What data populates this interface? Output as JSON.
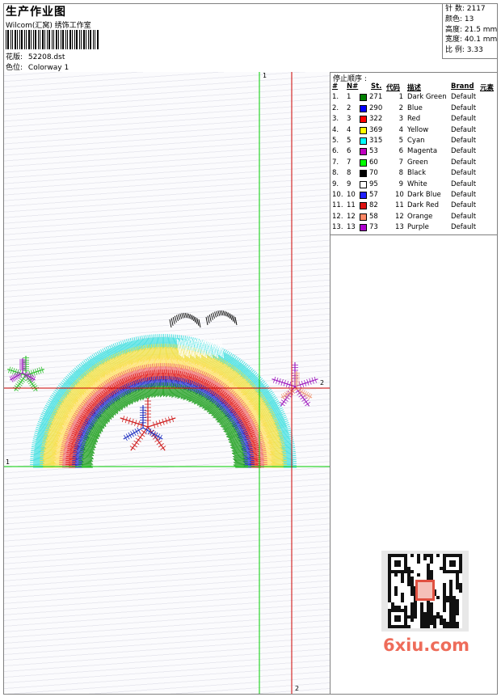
{
  "header": {
    "title": "生产作业图",
    "company": "Wilcom(汇窝) 绣饰工作室",
    "design_label": "花版:",
    "design_value": "52208.dst",
    "colorway_label": "色位:",
    "colorway_value": "Colorway 1"
  },
  "stats": {
    "stitches": "针 数: 2117",
    "colors": "颜色: 13",
    "height": "高度: 21.5 mm",
    "width": "宽度: 40.1 mm",
    "ratio": "比 例: 3.33"
  },
  "sequence": {
    "title": "停止顺序 :",
    "headers": {
      "n": "#",
      "no": "N#",
      "st": "St.",
      "code": "代码",
      "desc": "描述",
      "brand": "Brand",
      "elem": "元素"
    },
    "rows": [
      {
        "idx": "1.",
        "n": "1",
        "color": "#008000",
        "st": "271",
        "code": "1",
        "desc": "Dark Green",
        "brand": "Default"
      },
      {
        "idx": "2.",
        "n": "2",
        "color": "#0000ff",
        "st": "290",
        "code": "2",
        "desc": "Blue",
        "brand": "Default"
      },
      {
        "idx": "3.",
        "n": "3",
        "color": "#ff0000",
        "st": "322",
        "code": "3",
        "desc": "Red",
        "brand": "Default"
      },
      {
        "idx": "4.",
        "n": "4",
        "color": "#ffff00",
        "st": "369",
        "code": "4",
        "desc": "Yellow",
        "brand": "Default"
      },
      {
        "idx": "5.",
        "n": "5",
        "color": "#00ffff",
        "st": "315",
        "code": "5",
        "desc": "Cyan",
        "brand": "Default"
      },
      {
        "idx": "6.",
        "n": "6",
        "color": "#c000c0",
        "st": "53",
        "code": "6",
        "desc": "Magenta",
        "brand": "Default"
      },
      {
        "idx": "7.",
        "n": "7",
        "color": "#00ff00",
        "st": "60",
        "code": "7",
        "desc": "Green",
        "brand": "Default"
      },
      {
        "idx": "8.",
        "n": "8",
        "color": "#000000",
        "st": "70",
        "code": "8",
        "desc": "Black",
        "brand": "Default"
      },
      {
        "idx": "9.",
        "n": "9",
        "color": "#ffffff",
        "st": "95",
        "code": "9",
        "desc": "White",
        "brand": "Default"
      },
      {
        "idx": "10.",
        "n": "10",
        "color": "#2020ff",
        "st": "57",
        "code": "10",
        "desc": "Dark Blue",
        "brand": "Default"
      },
      {
        "idx": "11.",
        "n": "11",
        "color": "#dd1111",
        "st": "82",
        "code": "11",
        "desc": "Dark Red",
        "brand": "Default"
      },
      {
        "idx": "12.",
        "n": "12",
        "color": "#ff8866",
        "st": "58",
        "code": "12",
        "desc": "Orange",
        "brand": "Default"
      },
      {
        "idx": "13.",
        "n": "13",
        "color": "#b000d0",
        "st": "73",
        "code": "13",
        "desc": "Purple",
        "brand": "Default"
      }
    ]
  },
  "guides": {
    "v1": "1",
    "h1": "1",
    "v2": "2",
    "h2": "2"
  },
  "watermark": {
    "text": "6xiu.com",
    "seal": "汉字 图库"
  }
}
